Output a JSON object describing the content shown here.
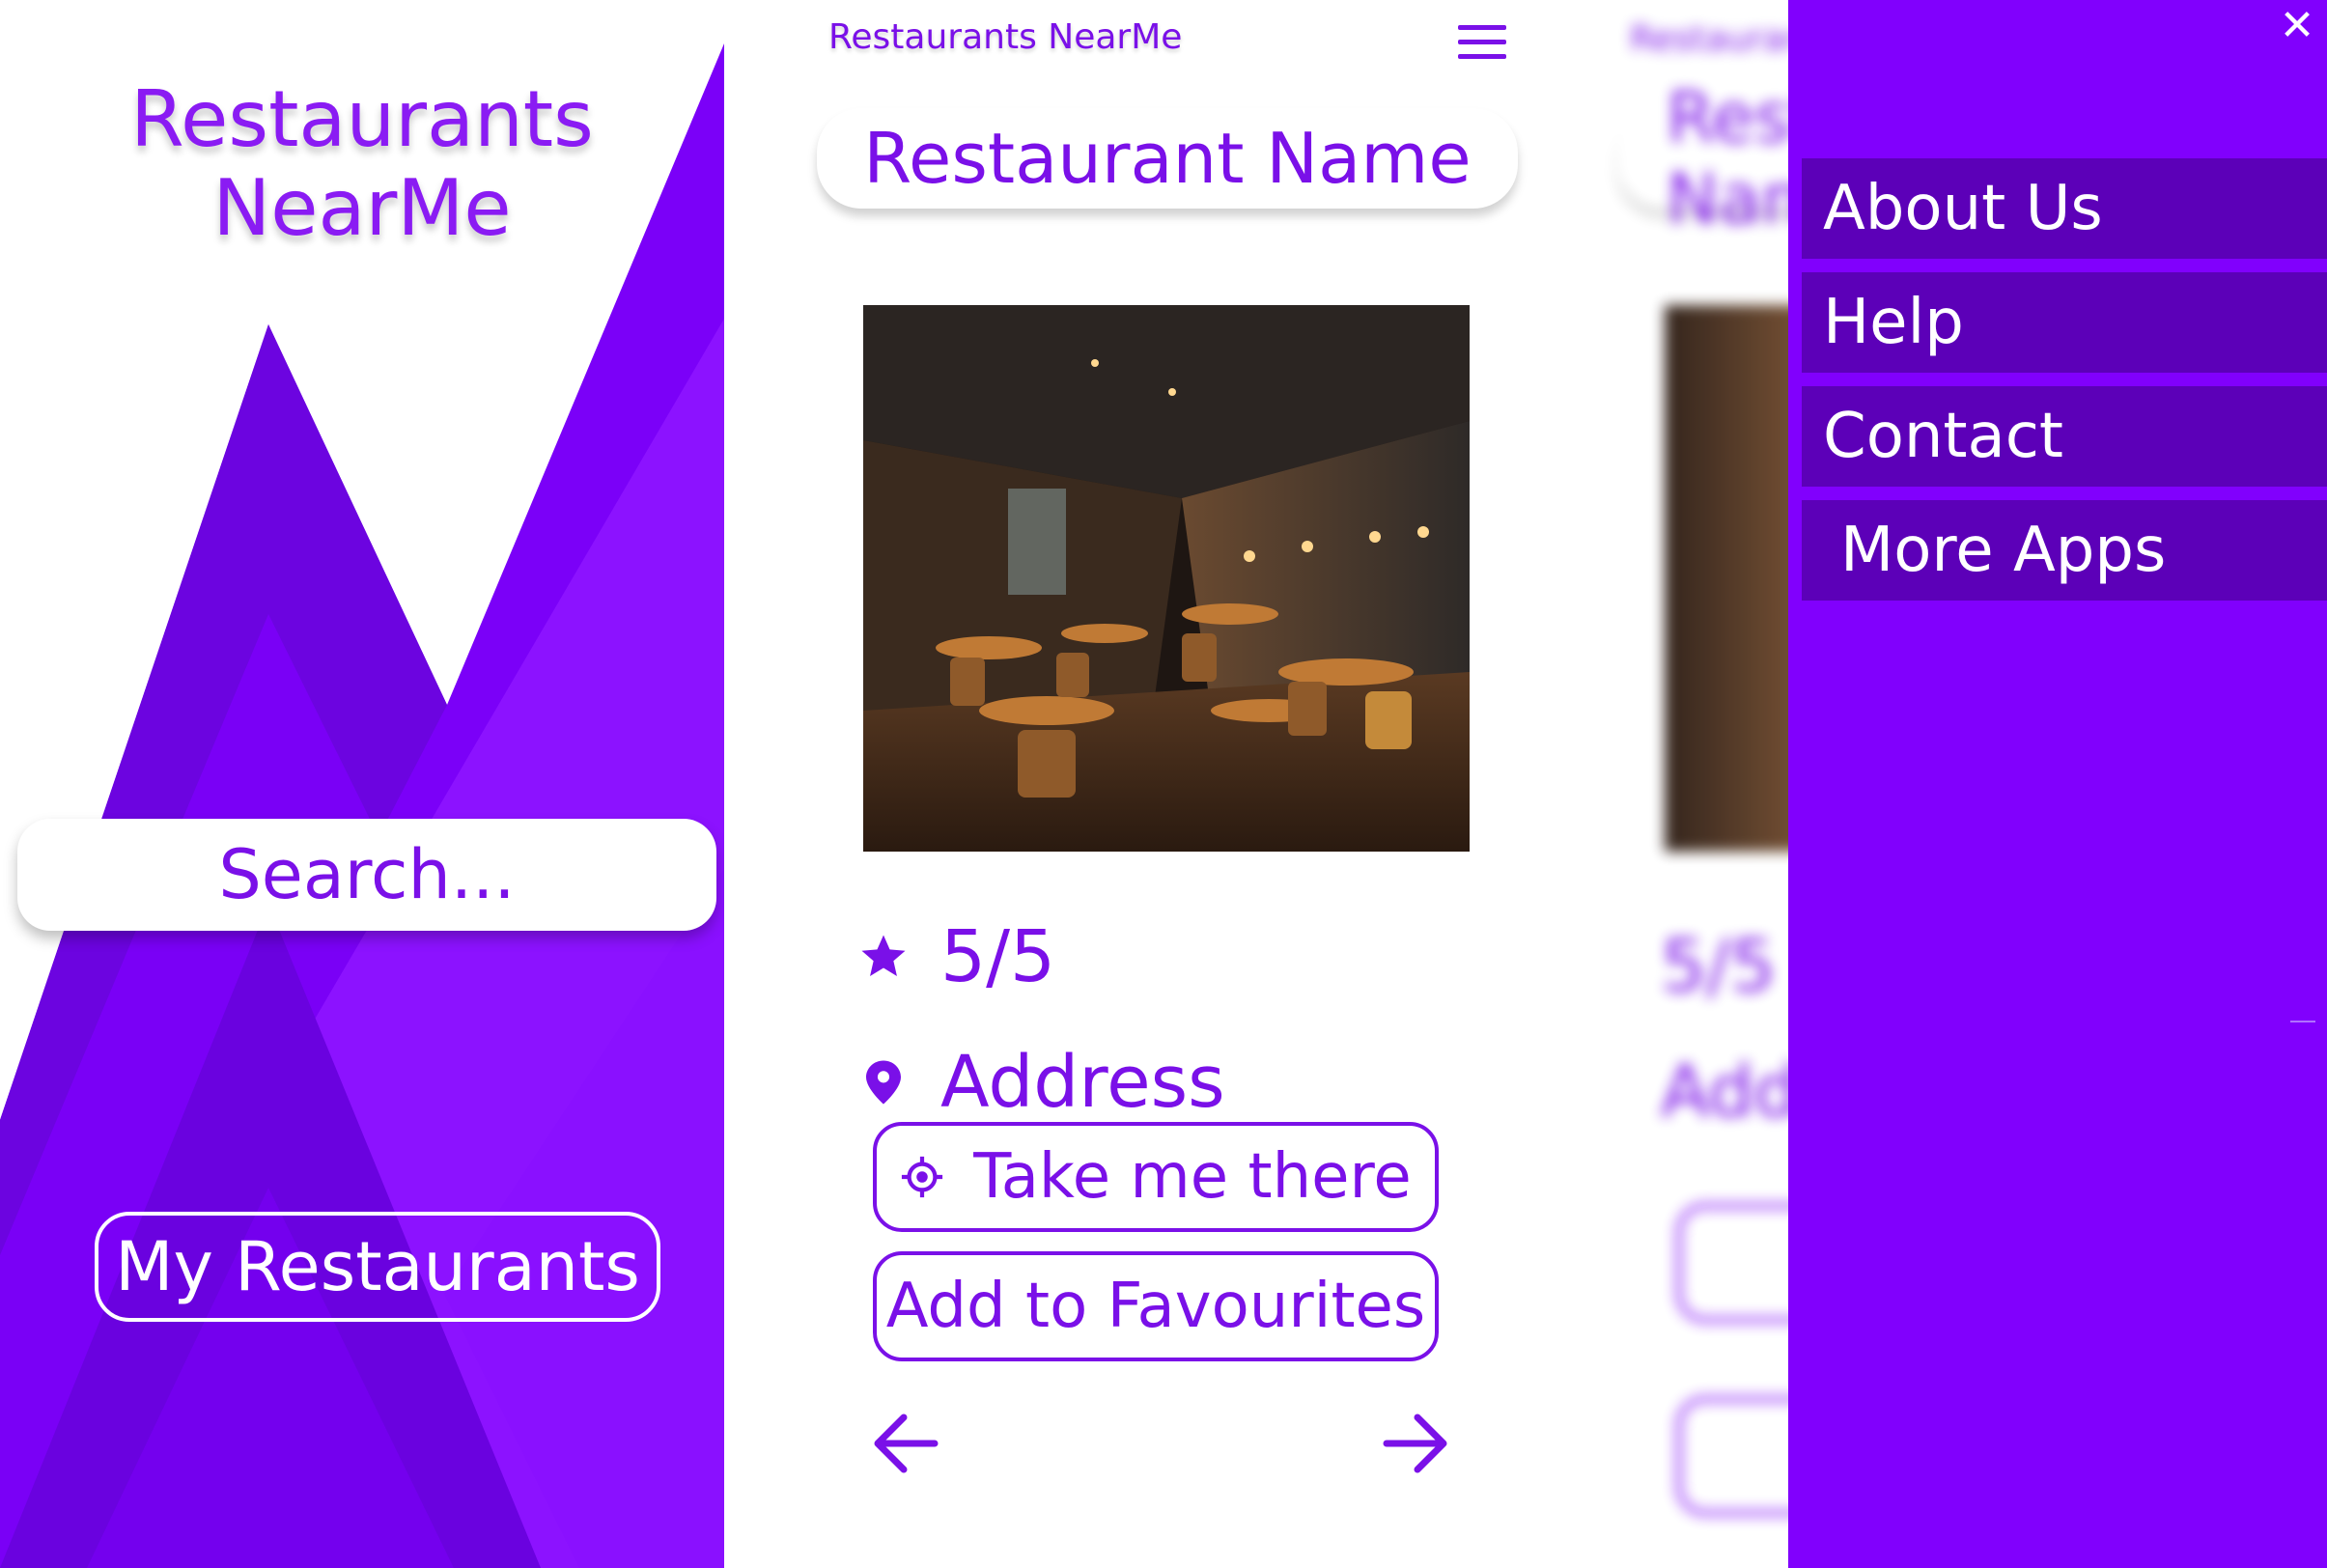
{
  "colors": {
    "primary": "#7a10e8",
    "bright_purple": "#8100fd",
    "dark_purple": "#5c00b8",
    "white": "#ffffff"
  },
  "splash": {
    "title_line1": "Restaurants",
    "title_line2": "NearMe",
    "search_placeholder": "Search...",
    "my_restaurants_label": "My Restaurants"
  },
  "detail": {
    "header_title": "Restaurants NearMe",
    "menu_icon": "hamburger-menu-icon",
    "restaurant_name": "Restaurant Name",
    "rating": "5/5",
    "rating_icon": "star-icon",
    "address": "Address",
    "address_icon": "location-pin-icon",
    "take_me_there_label": "Take me there",
    "take_me_there_icon": "crosshair-location-icon",
    "add_favourites_label": "Add to Favourites",
    "prev_icon": "arrow-left-icon",
    "next_icon": "arrow-right-icon"
  },
  "background_blurred": {
    "header_title": "Restaurants NearMe",
    "restaurant_name": "Restaurant Name",
    "rating": "5/5",
    "address": "Address"
  },
  "drawer": {
    "close_icon": "close-icon",
    "close_glyph": "✕",
    "items": [
      {
        "label": "About Us"
      },
      {
        "label": "Help"
      },
      {
        "label": "Contact"
      },
      {
        "label": "More Apps"
      }
    ]
  }
}
